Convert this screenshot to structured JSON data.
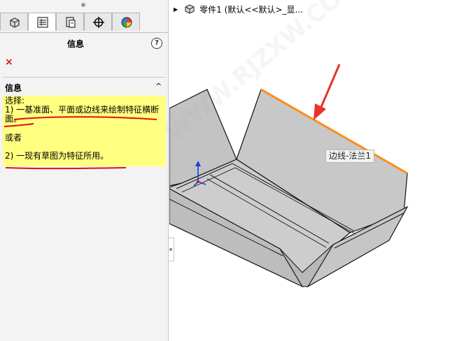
{
  "panel": {
    "title": "信息",
    "help_symbol": "?",
    "close_symbol": "×",
    "tabs": [
      {
        "name": "feature-manager",
        "icon": "feature-tree-icon"
      },
      {
        "name": "property-manager",
        "icon": "property-list-icon"
      },
      {
        "name": "configuration-manager",
        "icon": "configuration-icon"
      },
      {
        "name": "dimxpert-manager",
        "icon": "crosshair-icon"
      },
      {
        "name": "display-manager",
        "icon": "appearance-ball-icon"
      }
    ],
    "section": {
      "title": "信息",
      "collapse_symbol": "^",
      "message": {
        "line1": "选择:",
        "line2": "1) 一基准面、平面或边线来绘制特征横断面。",
        "or": "或者",
        "line3": "2) 一现有草图为特征所用。",
        "background": "#ffff80"
      }
    }
  },
  "breadcrumb": {
    "arrow": "▶",
    "part_icon": "part-icon",
    "text": "零件1 (默认<<默认>_显..."
  },
  "tooltip": {
    "text": "边线-法兰1"
  },
  "colors": {
    "selected_edge": "#ff8c1a",
    "annotation_red": "#e8332a",
    "sheet_fill": "#c8c8c8",
    "underline_red": "#e01010"
  }
}
